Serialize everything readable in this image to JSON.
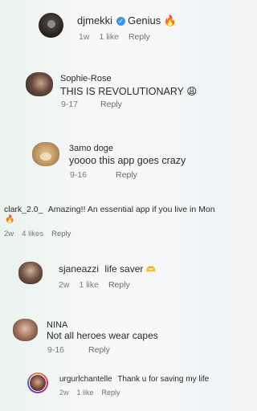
{
  "comments": [
    {
      "username": "djmekki",
      "verified": true,
      "text": "Genius",
      "emoji": "🔥",
      "time": "1w",
      "likes": "1 like",
      "reply": "Reply"
    },
    {
      "username": "Sophie-Rose",
      "text": "THIS IS REVOLUTIONARY",
      "emoji": "😩",
      "time": "9-17",
      "reply": "Reply"
    },
    {
      "username": "3amo doge",
      "text": "yoooo this app goes crazy",
      "time": "9-16",
      "reply": "Reply"
    },
    {
      "username": "clark_2.0_",
      "text": "Amazing!! An essential app if you live in Mon",
      "emoji": "🔥",
      "time": "2w",
      "likes": "4 likes",
      "reply": "Reply"
    },
    {
      "username": "sjaneazzi",
      "text": "life saver",
      "emoji": "🫶",
      "time": "2w",
      "likes": "1 like",
      "reply": "Reply"
    },
    {
      "username": "NINA",
      "text": "Not all heroes wear capes",
      "time": "9-16",
      "reply": "Reply"
    },
    {
      "username": "urgurlchantelle",
      "text": "Thank u for saving my life",
      "time": "2w",
      "likes": "1 like",
      "reply": "Reply"
    }
  ]
}
